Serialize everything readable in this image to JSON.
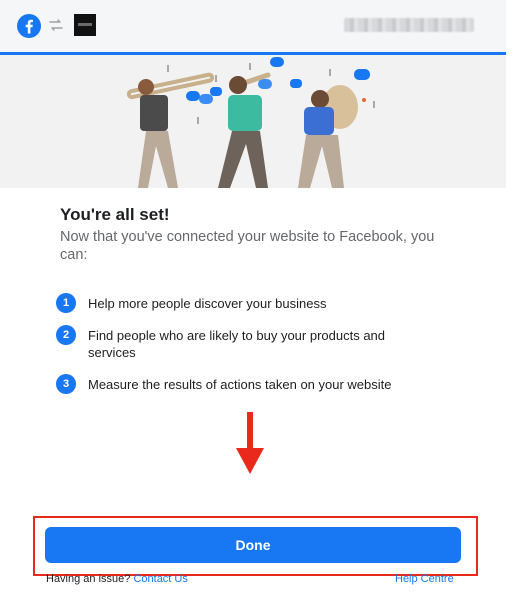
{
  "header": {
    "logo_icon": "facebook-logo-icon",
    "sync_icon": "sync-icon",
    "site_icon": "website-thumbnail-icon",
    "brand_color": "#1877f2"
  },
  "main": {
    "title": "You're all set!",
    "subtitle": "Now that you've connected your website to Facebook, you can:",
    "benefits": [
      {
        "number": "1",
        "text": "Help more people discover your business"
      },
      {
        "number": "2",
        "text": "Find people who are likely to buy your products and services"
      },
      {
        "number": "3",
        "text": "Measure the results of actions taken on your website"
      }
    ]
  },
  "actions": {
    "done_label": "Done",
    "annotation_color": "#e8291c"
  },
  "footer": {
    "issue_text": "Having an issue?",
    "contact_link": "Contact Us",
    "help_link": "Help Centre"
  }
}
